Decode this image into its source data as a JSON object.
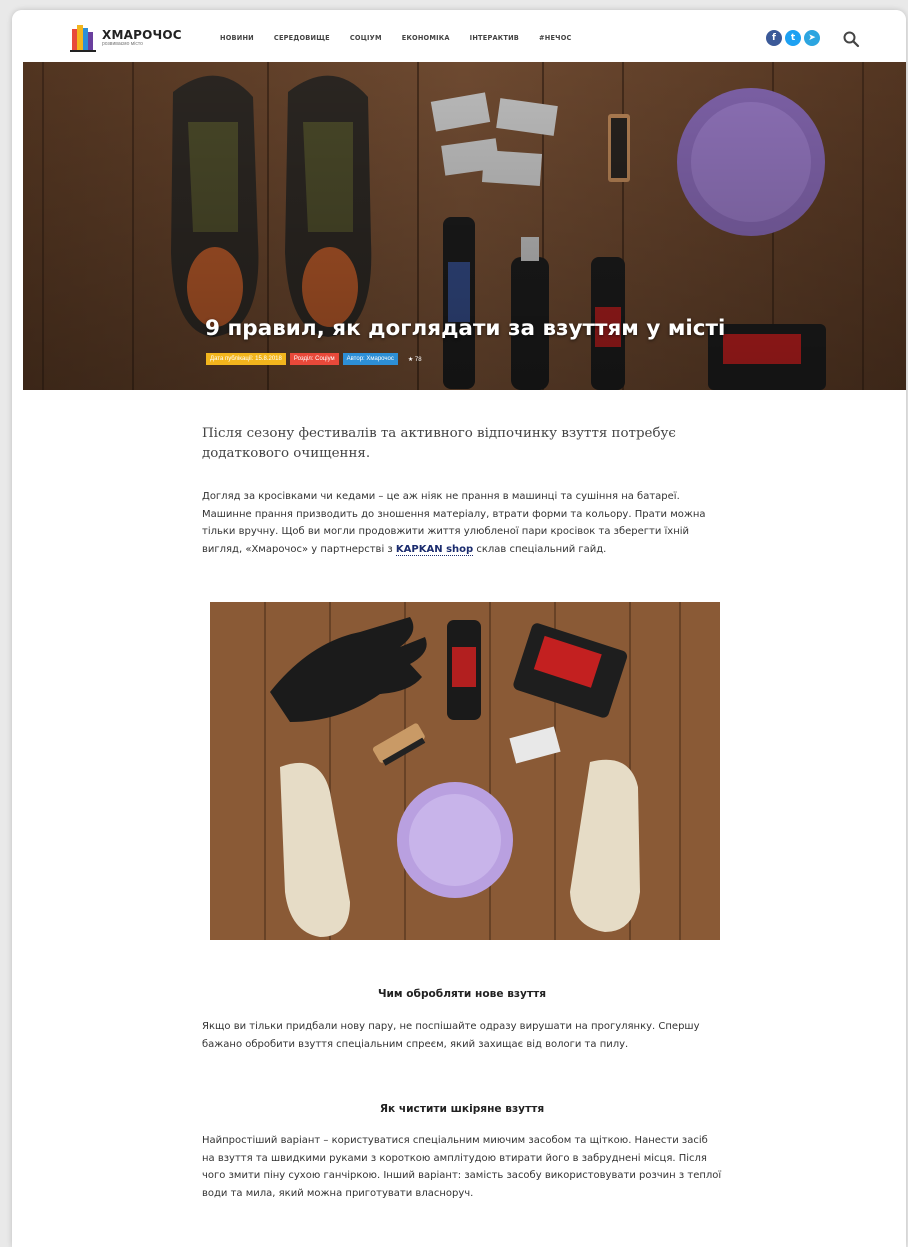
{
  "site": {
    "name": "ХМАРОЧОС",
    "tagline": "розвиваємо місто"
  },
  "nav": [
    "НОВИНИ",
    "СЕРЕДОВИЩЕ",
    "СОЦІУМ",
    "ЕКОНОМІКА",
    "ІНТЕРАКТИВ",
    "#НЕЧОС"
  ],
  "social": {
    "facebook": "f",
    "twitter": "t",
    "telegram": "➤"
  },
  "colors": {
    "date_tag": "#f2b51d",
    "section_tag": "#e8493a",
    "author_tag": "#2d8fd6",
    "link": "#1b2c6e"
  },
  "article": {
    "title": "9 правил, як доглядати за взуттям у місті",
    "date_tag": "Дата публікації: 15.8.2018",
    "section_tag": "Розділ: Соціум",
    "author_tag": "Автор: Хмарочос",
    "views": "78",
    "lead": "Після сезону фестивалів та активного відпочинку взуття потребує додаткового очищення.",
    "intro_text": "Догляд за кросівками чи кедами – це аж ніяк не прання в машинці та сушіння на батареї. Машинне прання призводить до зношення матеріалу, втрати форми та кольору. Прати можна тільки вручну. Щоб ви могли продовжити життя улюбленої пари кросівок та зберегти їхній вигляд, «Хмарочос» у партнерстві з",
    "partner_link": "KAPKAN shop",
    "intro_tail": "склав спеціальний гайд.",
    "section1_heading": "Чим обробляти нове взуття",
    "section1_text": "Якщо ви тільки придбали нову пару, не поспішайте одразу вирушати на прогулянку. Спершу бажано обробити взуття спеціальним спреєм, який захищає від вологи та пилу.",
    "section2_heading": "Як чистити шкіряне взуття",
    "section2_text": "Найпростіший варіант – користуватися спеціальним миючим засобом та щіткою. Нанести засіб на взуття та швидкими руками з короткою амплітудою втирати його в забруднені місця. Після чого змити піну сухою ганчіркою. Інший варіант: замість засобу використовувати розчин з теплої води та мила, який можна приготувати власноруч."
  }
}
